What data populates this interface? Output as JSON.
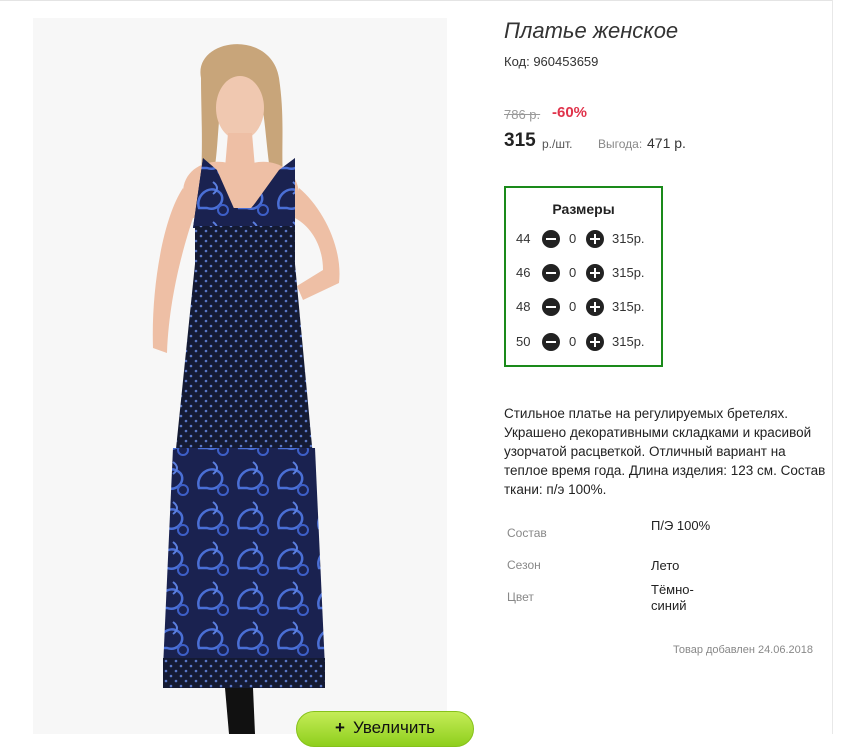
{
  "product": {
    "title": "Платье женское",
    "code": "Код: 960453659",
    "old_price": "786 р.",
    "discount": "-60%",
    "price": "315",
    "price_unit": "р./шт.",
    "saving_label": "Выгода:",
    "saving_value": "471 р."
  },
  "sizes": {
    "title": "Размеры",
    "rows": [
      {
        "size": "44",
        "qty": "0",
        "price": "315р."
      },
      {
        "size": "46",
        "qty": "0",
        "price": "315р."
      },
      {
        "size": "48",
        "qty": "0",
        "price": "315р."
      },
      {
        "size": "50",
        "qty": "0",
        "price": "315р."
      }
    ]
  },
  "description": "Стильное платье на регулируемых бретелях. Украшено декоративными складками и красивой узорчатой расцветкой. Отличный вариант на теплое время года. Длина изделия: 123 см. Состав ткани: п/э 100%.",
  "properties": [
    {
      "label": "Состав",
      "value": "П/Э 100%"
    },
    {
      "label": "Сезон",
      "value": "Лето"
    },
    {
      "label": "Цвет",
      "value": "Тёмно-синий"
    }
  ],
  "added": "Товар добавлен 24.06.2018",
  "zoom": {
    "label": "Увеличить",
    "icon": "plus-icon"
  },
  "colors": {
    "sizes_border": "#1a8a1a",
    "discount": "#e0334b",
    "zoom_button": "#a8dd3a",
    "dress": "#141a33",
    "pattern": "#3f63c8"
  }
}
